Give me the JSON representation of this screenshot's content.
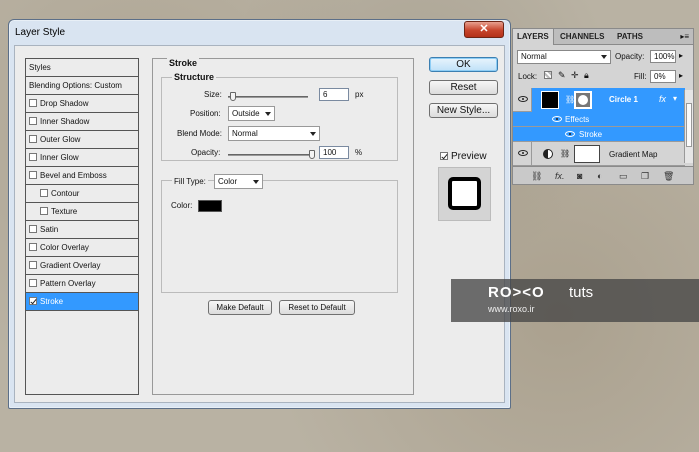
{
  "dialog": {
    "title": "Layer Style",
    "close_icon": "✕",
    "styles": [
      {
        "label": "Styles",
        "head": true
      },
      {
        "label": "Blending Options: Custom",
        "head": true
      },
      {
        "label": "Drop Shadow",
        "checked": false
      },
      {
        "label": "Inner Shadow",
        "checked": false
      },
      {
        "label": "Outer Glow",
        "checked": false
      },
      {
        "label": "Inner Glow",
        "checked": false
      },
      {
        "label": "Bevel and Emboss",
        "checked": false
      },
      {
        "label": "Contour",
        "checked": false,
        "indent": true
      },
      {
        "label": "Texture",
        "checked": false,
        "indent": true
      },
      {
        "label": "Satin",
        "checked": false
      },
      {
        "label": "Color Overlay",
        "checked": false
      },
      {
        "label": "Gradient Overlay",
        "checked": false
      },
      {
        "label": "Pattern Overlay",
        "checked": false
      },
      {
        "label": "Stroke",
        "checked": true,
        "selected": true
      }
    ],
    "stroke": {
      "title": "Stroke",
      "structure_title": "Structure",
      "size_label": "Size:",
      "size_value": "6",
      "size_unit": "px",
      "position_label": "Position:",
      "position_value": "Outside",
      "blend_label": "Blend Mode:",
      "blend_value": "Normal",
      "opacity_label": "Opacity:",
      "opacity_value": "100",
      "opacity_unit": "%",
      "fill_type_label": "Fill Type:",
      "fill_type_value": "Color",
      "color_label": "Color:",
      "color_value": "#000000",
      "make_default": "Make Default",
      "reset_default": "Reset to Default"
    },
    "buttons": {
      "ok": "OK",
      "reset": "Reset",
      "new_style": "New Style...",
      "preview": "Preview"
    }
  },
  "layers_panel": {
    "tabs": [
      "LAYERS",
      "CHANNELS",
      "PATHS"
    ],
    "blend_mode": "Normal",
    "opacity_label": "Opacity:",
    "opacity_value": "100%",
    "lock_label": "Lock:",
    "fill_label": "Fill:",
    "fill_value": "0%",
    "layers": [
      {
        "name": "Circle 1",
        "fx": "fx",
        "selected": true
      },
      {
        "name": "Effects",
        "sub": true
      },
      {
        "name": "Stroke",
        "sub": true
      },
      {
        "name": "Gradient Map"
      }
    ],
    "accent": "#3399ff"
  },
  "watermark": {
    "logo": "RO><O",
    "tuts": "tuts",
    "url": "www.roxo.ir"
  }
}
